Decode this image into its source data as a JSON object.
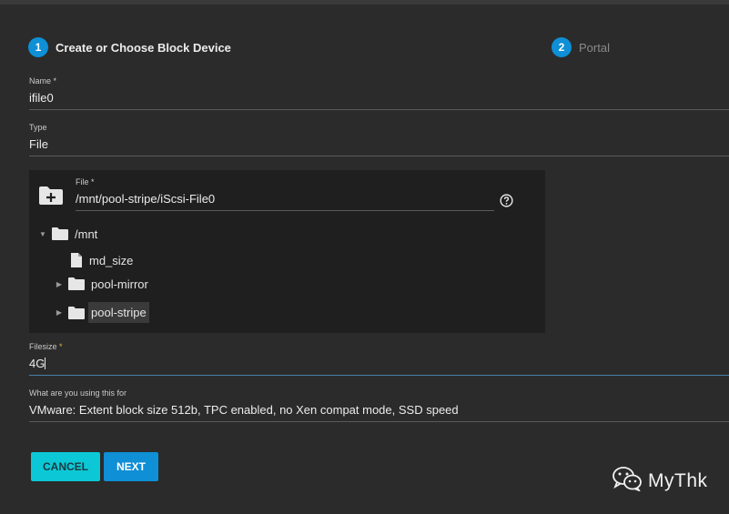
{
  "wizard": {
    "steps": [
      {
        "number": "1",
        "label": "Create or Choose Block Device"
      },
      {
        "number": "2",
        "label": "Portal"
      }
    ]
  },
  "form": {
    "name": {
      "label": "Name",
      "required_mark": "*",
      "value": "ifile0"
    },
    "type": {
      "label": "Type",
      "value": "File"
    },
    "file": {
      "label": "File",
      "required_mark": "*",
      "value": "/mnt/pool-stripe/iScsi-File0"
    },
    "filesize": {
      "label": "Filesize",
      "required_mark": "*",
      "value": "4G"
    },
    "usage": {
      "label": "What are you using this for",
      "value": "VMware: Extent block size 512b, TPC enabled, no Xen compat mode, SSD speed"
    }
  },
  "tree": {
    "root": {
      "label": "/mnt"
    },
    "items": [
      {
        "label": "md_size"
      },
      {
        "label": "pool-mirror"
      },
      {
        "label": "pool-stripe"
      }
    ]
  },
  "buttons": {
    "cancel": "CANCEL",
    "next": "NEXT"
  },
  "watermark": {
    "text": "MyThk"
  },
  "colors": {
    "accent": "#0e8fd6",
    "cancel": "#0cc8d6",
    "background": "#2b2b2b",
    "panel": "#1f1f1f"
  }
}
